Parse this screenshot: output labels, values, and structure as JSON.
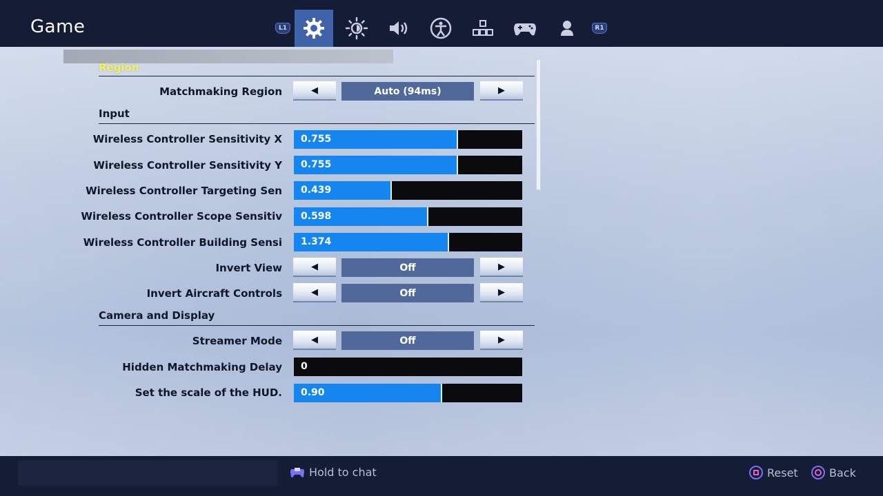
{
  "header": {
    "title": "Game",
    "left_shoulder": "L1",
    "right_shoulder": "R1",
    "tabs": [
      {
        "icon": "gear-icon",
        "active": true
      },
      {
        "icon": "brightness-icon",
        "active": false
      },
      {
        "icon": "audio-icon",
        "active": false
      },
      {
        "icon": "accessibility-icon",
        "active": false
      },
      {
        "icon": "input-icon",
        "active": false
      },
      {
        "icon": "controller-icon",
        "active": false
      },
      {
        "icon": "account-icon",
        "active": false
      }
    ]
  },
  "sections": {
    "region": {
      "title": "Region",
      "matchmaking_region": {
        "label": "Matchmaking Region",
        "value": "Auto (94ms)"
      }
    },
    "input": {
      "title": "Input",
      "sens_x": {
        "label": "Wireless Controller Sensitivity X",
        "value": "0.755",
        "fill": 0.72
      },
      "sens_y": {
        "label": "Wireless Controller Sensitivity Y",
        "value": "0.755",
        "fill": 0.72
      },
      "targeting": {
        "label": "Wireless Controller Targeting Sen",
        "value": "0.439",
        "fill": 0.43
      },
      "scope": {
        "label": "Wireless Controller Scope Sensitiv",
        "value": "0.598",
        "fill": 0.59
      },
      "building": {
        "label": "Wireless Controller Building Sensi",
        "value": "1.374",
        "fill": 0.68
      },
      "invert_view": {
        "label": "Invert View",
        "value": "Off"
      },
      "invert_aircraft": {
        "label": "Invert Aircraft Controls",
        "value": "Off"
      }
    },
    "camera": {
      "title": "Camera and Display",
      "streamer_mode": {
        "label": "Streamer Mode",
        "value": "Off"
      },
      "hidden_delay": {
        "label": "Hidden Matchmaking Delay",
        "value": "0"
      },
      "hud_scale": {
        "label": "Set the scale of the HUD.",
        "value": "0.90",
        "fill": 0.65
      }
    }
  },
  "arrows": {
    "left": "◀",
    "right": "▶"
  },
  "footer": {
    "chat_hint": "Hold to chat",
    "reset_label": "Reset",
    "back_label": "Back"
  },
  "colors": {
    "accent_fill": "#1586f0",
    "active_tab": "#3e63a8",
    "region_highlight": "#f2f25a"
  }
}
